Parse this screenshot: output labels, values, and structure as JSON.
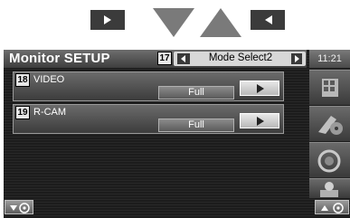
{
  "screen": {
    "title": "Monitor SETUP",
    "mode_badge": "17",
    "mode_label": "Mode Select2",
    "time": "11:21"
  },
  "rows": [
    {
      "badge": "18",
      "label": "VIDEO",
      "value": "Full"
    },
    {
      "badge": "19",
      "label": "R-CAM",
      "value": "Full"
    }
  ],
  "sidebar": {
    "icons": [
      "menu-grid-icon",
      "media-disc-icon",
      "audio-knob-icon",
      "setup-tools-icon"
    ]
  },
  "bottom": {
    "left_icon": "volume-down-icon",
    "right_icon": "volume-up-icon"
  },
  "colors": {
    "screen_bg": "#1c1c1c",
    "mode_box": "#d8d8d8",
    "step_arrow": "#3b3b3b",
    "step_triangle": "#7a7a7a"
  }
}
